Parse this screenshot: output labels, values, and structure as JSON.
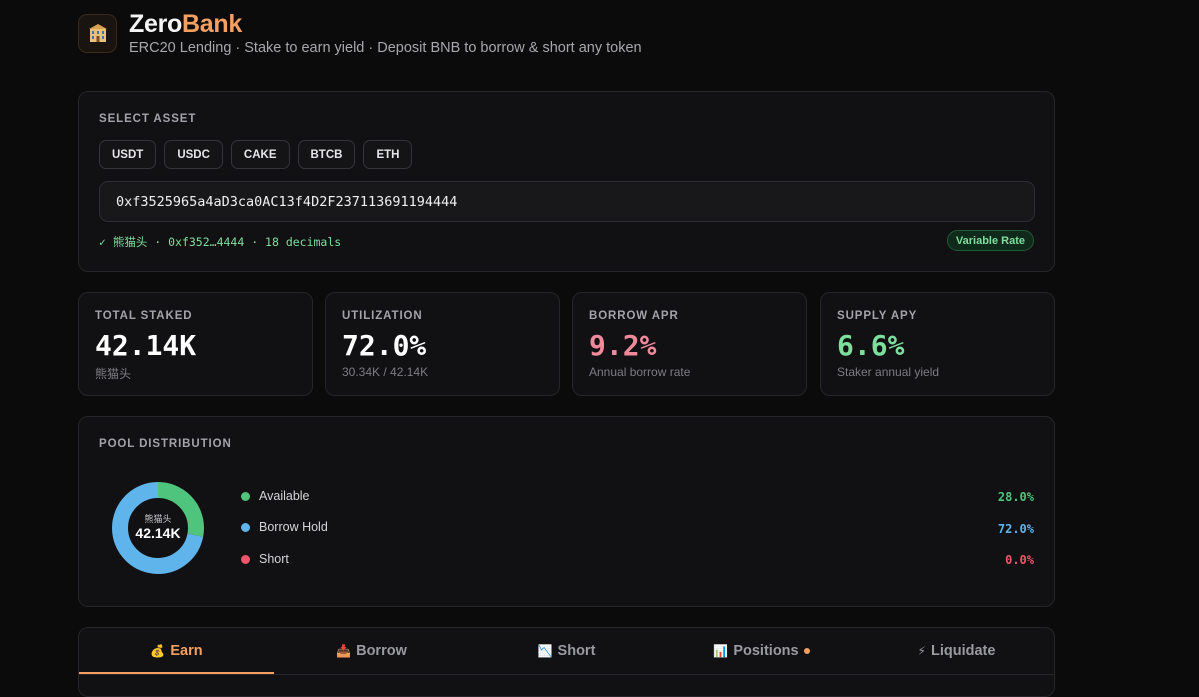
{
  "header": {
    "logo_icon": "bank-building-icon",
    "brand_prefix": "Zero",
    "brand_suffix": "Bank",
    "subtitle": "ERC20 Lending · Stake to earn yield · Deposit BNB to borrow & short any token"
  },
  "asset_selector": {
    "label": "SELECT ASSET",
    "assets": [
      "USDT",
      "USDC",
      "CAKE",
      "BTCB",
      "ETH"
    ],
    "address_value": "0xf3525965a4aD3ca0AC13f4D2F237113691194444",
    "token_info": "✓ 熊猫头 · 0xf352…4444 · 18 decimals",
    "rate_badge": "Variable Rate"
  },
  "stats": [
    {
      "label": "TOTAL STAKED",
      "value": "42.14K",
      "sub": "熊猫头",
      "color": "#ffffff"
    },
    {
      "label": "UTILIZATION",
      "value": "72.0%",
      "sub": "30.34K / 42.14K",
      "color": "#ffffff"
    },
    {
      "label": "BORROW APR",
      "value": "9.2%",
      "sub": "Annual borrow rate",
      "color": "#f08a9a"
    },
    {
      "label": "SUPPLY APY",
      "value": "6.6%",
      "sub": "Staker annual yield",
      "color": "#7ddf9d"
    }
  ],
  "pool": {
    "label": "POOL DISTRIBUTION",
    "center_unit": "熊猫头",
    "center_value": "42.14K",
    "segments": [
      {
        "name": "Available",
        "pct_text": "28.0%",
        "fraction": 0.28,
        "color": "#4fc47c"
      },
      {
        "name": "Borrow Hold",
        "pct_text": "72.0%",
        "fraction": 0.72,
        "color": "#5fb4ec"
      },
      {
        "name": "Short",
        "pct_text": "0.0%",
        "fraction": 0.0,
        "color": "#f0566b"
      }
    ]
  },
  "tabs": [
    {
      "icon": "💰",
      "icon_name": "money-bag-icon",
      "label": "Earn",
      "active": true
    },
    {
      "icon": "📥",
      "icon_name": "inbox-tray-icon",
      "label": "Borrow",
      "active": false
    },
    {
      "icon": "📉",
      "icon_name": "chart-down-icon",
      "label": "Short",
      "active": false
    },
    {
      "icon": "📊",
      "icon_name": "bar-chart-icon",
      "label": "Positions",
      "active": false,
      "dot": true
    },
    {
      "icon": "⚡",
      "icon_name": "lightning-icon",
      "label": "Liquidate",
      "active": false
    }
  ]
}
